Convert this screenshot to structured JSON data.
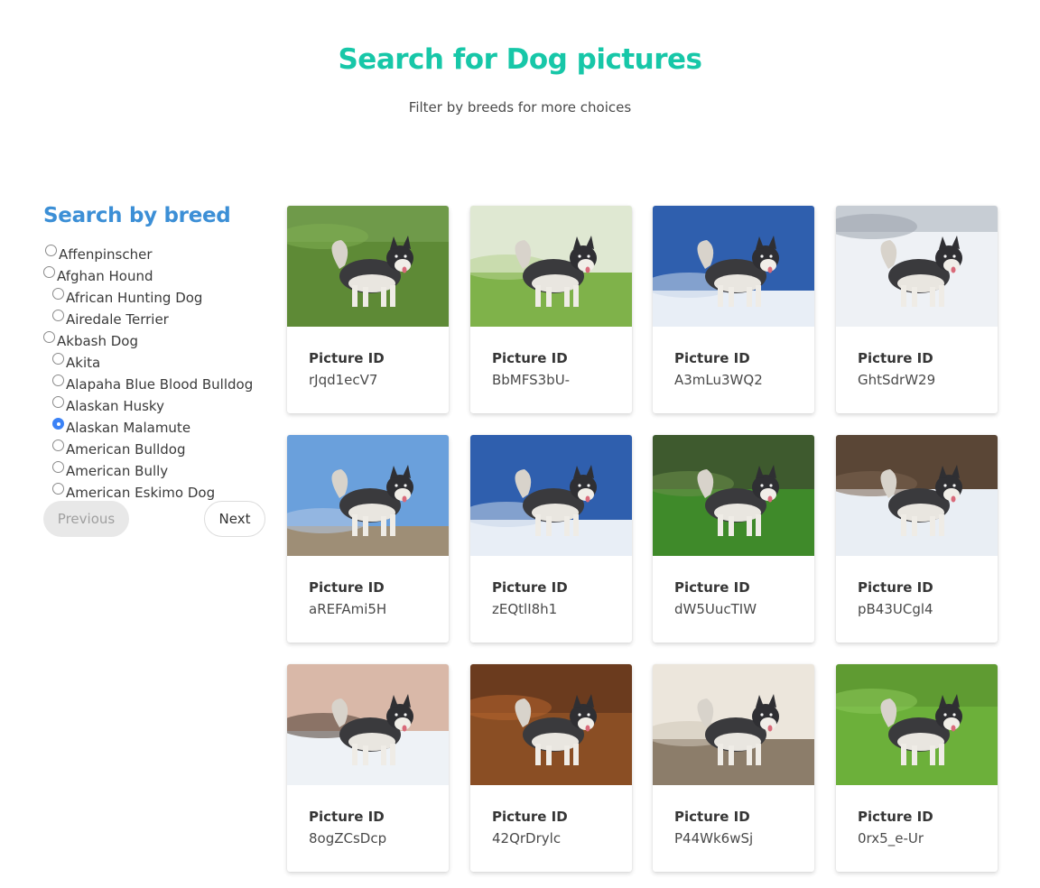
{
  "hero": {
    "title": "Search for Dog pictures",
    "subtitle": "Filter by breeds for more choices"
  },
  "sidebar": {
    "heading": "Search by breed",
    "breeds": [
      {
        "label": "Affenpinscher",
        "checked": false
      },
      {
        "label": "Afghan Hound",
        "checked": false
      },
      {
        "label": "African Hunting Dog",
        "checked": false
      },
      {
        "label": "Airedale Terrier",
        "checked": false
      },
      {
        "label": "Akbash Dog",
        "checked": false
      },
      {
        "label": "Akita",
        "checked": false
      },
      {
        "label": "Alapaha Blue Blood Bulldog",
        "checked": false
      },
      {
        "label": "Alaskan Husky",
        "checked": false
      },
      {
        "label": "Alaskan Malamute",
        "checked": true
      },
      {
        "label": "American Bulldog",
        "checked": false
      },
      {
        "label": "American Bully",
        "checked": false
      },
      {
        "label": "American Eskimo Dog",
        "checked": false
      }
    ]
  },
  "pager": {
    "previous_label": "Previous",
    "next_label": "Next"
  },
  "cards": [
    {
      "label": "Picture ID",
      "id": "rJqd1ecV7",
      "scene": "grass"
    },
    {
      "label": "Picture ID",
      "id": "BbMFS3bU-",
      "scene": "grass-light"
    },
    {
      "label": "Picture ID",
      "id": "A3mLu3WQ2",
      "scene": "snow-sky"
    },
    {
      "label": "Picture ID",
      "id": "GhtSdrW29",
      "scene": "snow-fence"
    },
    {
      "label": "Picture ID",
      "id": "aREFAmi5H",
      "scene": "sky-rock"
    },
    {
      "label": "Picture ID",
      "id": "zEQtlI8h1",
      "scene": "snow-sky"
    },
    {
      "label": "Picture ID",
      "id": "dW5UucTIW",
      "scene": "grass-trees"
    },
    {
      "label": "Picture ID",
      "id": "pB43UCgl4",
      "scene": "snow-forest"
    },
    {
      "label": "Picture ID",
      "id": "8ogZCsDcp",
      "scene": "snow-sunset"
    },
    {
      "label": "Picture ID",
      "id": "42QrDrylc",
      "scene": "autumn"
    },
    {
      "label": "Picture ID",
      "id": "P44Wk6wSj",
      "scene": "porch"
    },
    {
      "label": "Picture ID",
      "id": "0rx5_e-Ur",
      "scene": "grass-bright"
    }
  ],
  "colors": {
    "title": "#17c7a8",
    "heading": "#3c8fd6",
    "radio_checked": "#3b82f6"
  }
}
